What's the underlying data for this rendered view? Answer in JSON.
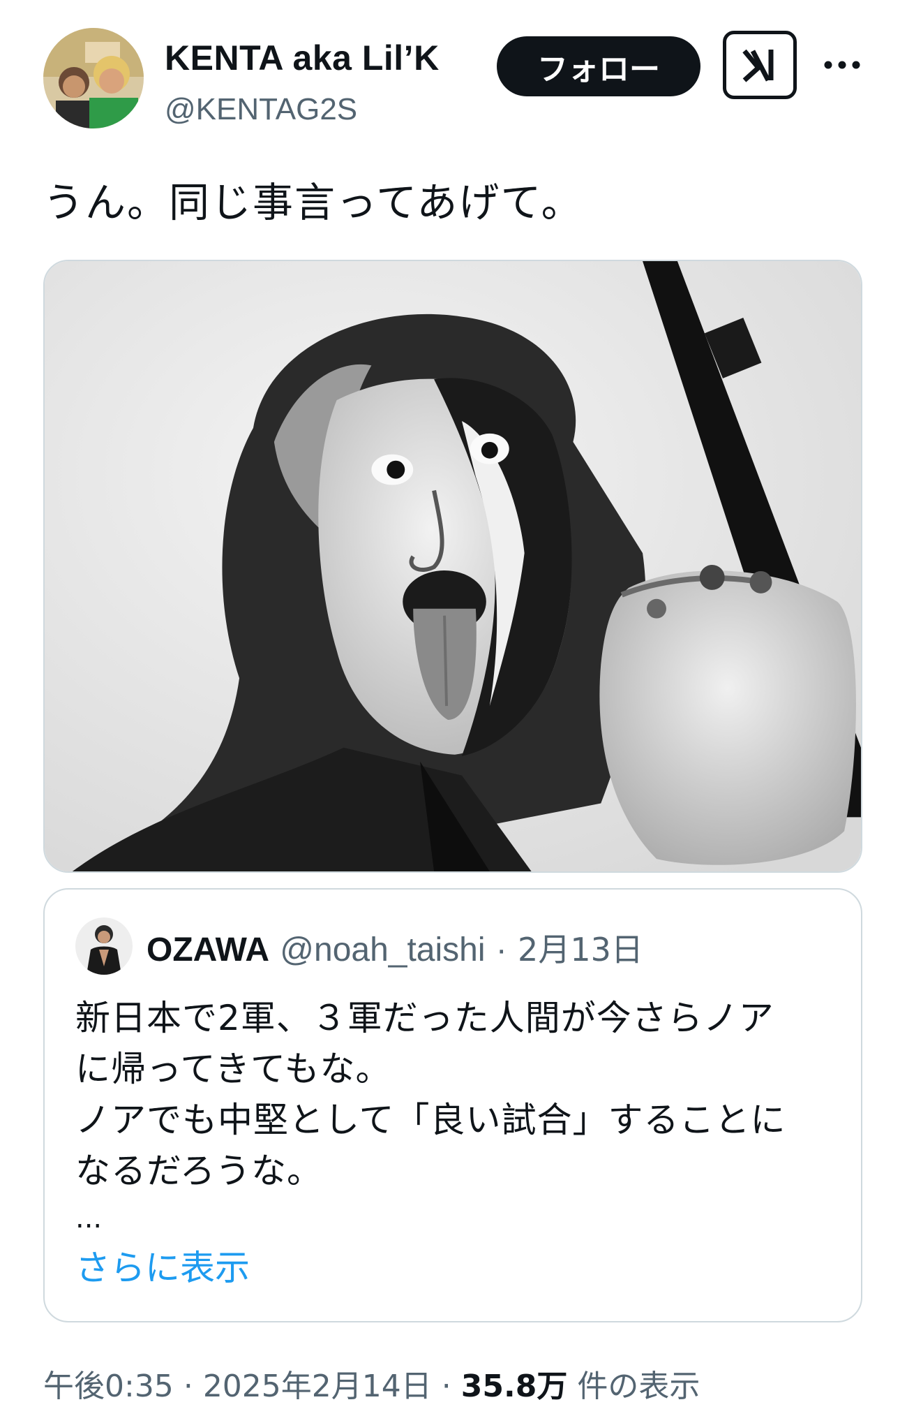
{
  "author": {
    "display_name": "KENTA aka Lil’K",
    "handle": "@KENTAG2S"
  },
  "actions": {
    "follow_label": "フォロー",
    "grok_icon": "grok-icon",
    "more_icon": "more-dots-icon"
  },
  "tweet": {
    "text": "うん。同じ事言ってあげて。"
  },
  "quoted": {
    "display_name": "OZAWA",
    "handle": "@noah_taishi",
    "separator": "·",
    "date": "2月13日",
    "lines": [
      "新日本で2軍、３軍だった人間が今さらノア",
      "に帰ってきてもな。",
      "ノアでも中堅として「良い試合」することに",
      "なるだろうな。"
    ],
    "ellipsis": "...",
    "show_more": "さらに表示"
  },
  "meta": {
    "time": "午後0:35",
    "sep1": "·",
    "date": "2025年2月14日",
    "sep2": "·",
    "views_count": "35.8万",
    "views_label": "件の表示"
  },
  "colors": {
    "text": "#0f1419",
    "secondary": "#536471",
    "link": "#1d9bf0",
    "border": "#cfd9de"
  }
}
